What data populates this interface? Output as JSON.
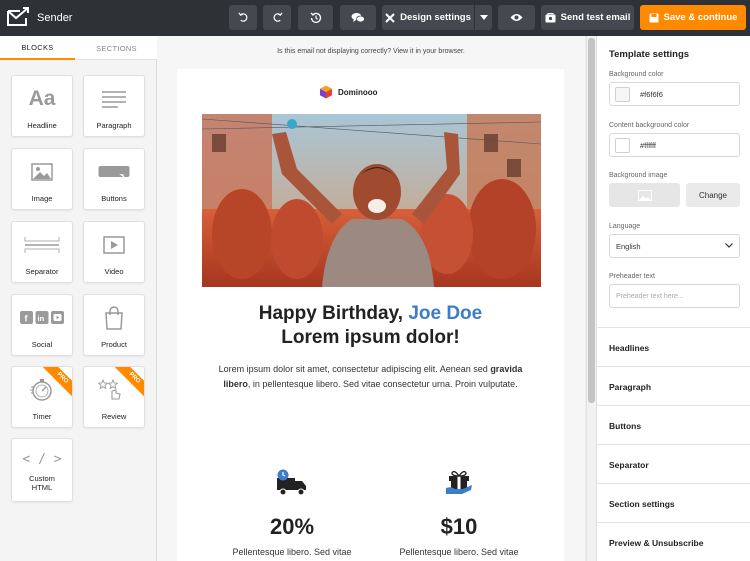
{
  "app": {
    "brand": "Sender"
  },
  "toolbar": {
    "undo_icon": "undo-icon",
    "redo_icon": "redo-icon",
    "history_icon": "history-icon",
    "comments_icon": "comments-icon",
    "design_settings_label": "Design settings",
    "preview_icon": "eye-icon",
    "send_test_label": "Send test email",
    "save_label": "Save & continue",
    "accent_color": "#ff8a00"
  },
  "left_panel": {
    "tabs": [
      {
        "label": "BLOCKS",
        "active": true
      },
      {
        "label": "SECTIONS",
        "active": false
      }
    ],
    "blocks": [
      {
        "label": "Headline"
      },
      {
        "label": "Paragraph"
      },
      {
        "label": "Image"
      },
      {
        "label": "Buttons"
      },
      {
        "label": "Separator"
      },
      {
        "label": "Video"
      },
      {
        "label": "Social"
      },
      {
        "label": "Product"
      },
      {
        "label": "Timer",
        "badge": "PRO"
      },
      {
        "label": "Review",
        "badge": "PRO"
      },
      {
        "label": "Custom HTML"
      }
    ]
  },
  "canvas": {
    "notice": "Is this email not displaying correctly? View it in your browser.",
    "email": {
      "brand": "Dominooo",
      "headline_part1": "Happy Birthday, ",
      "headline_name": "Joe Doe",
      "headline_line2": "Lorem ipsum dolor!",
      "accent_color": "#3d7cc9",
      "paragraph_before": "Lorem ipsum dolor sit amet, consectetur adipiscing elit. Aenean sed ",
      "paragraph_bold": "gravida libero",
      "paragraph_after": ", in pellentesque libero. Sed vitae consectetur urna. Proin vulputate.",
      "features": [
        {
          "icon": "delivery-truck-icon",
          "value": "20%",
          "text": "Pellentesque libero. Sed vitae consectetur urna. Proin vulputate."
        },
        {
          "icon": "gift-icon",
          "value": "$10",
          "text": "Pellentesque libero. Sed vitae consectetur urna. Proin vulputate."
        }
      ]
    }
  },
  "right_panel": {
    "title": "Template settings",
    "background_color_label": "Background color",
    "background_color": "#f6f6f6",
    "content_bg_label": "Content background color",
    "content_bg": "#ffffff",
    "background_image_label": "Background image",
    "change_label": "Change",
    "language_label": "Language",
    "language_value": "English",
    "preheader_label": "Preheader text",
    "preheader_placeholder": "Preheader text here...",
    "sections": [
      "Headlines",
      "Paragraph",
      "Buttons",
      "Separator",
      "Section settings",
      "Preview & Unsubscribe"
    ]
  }
}
